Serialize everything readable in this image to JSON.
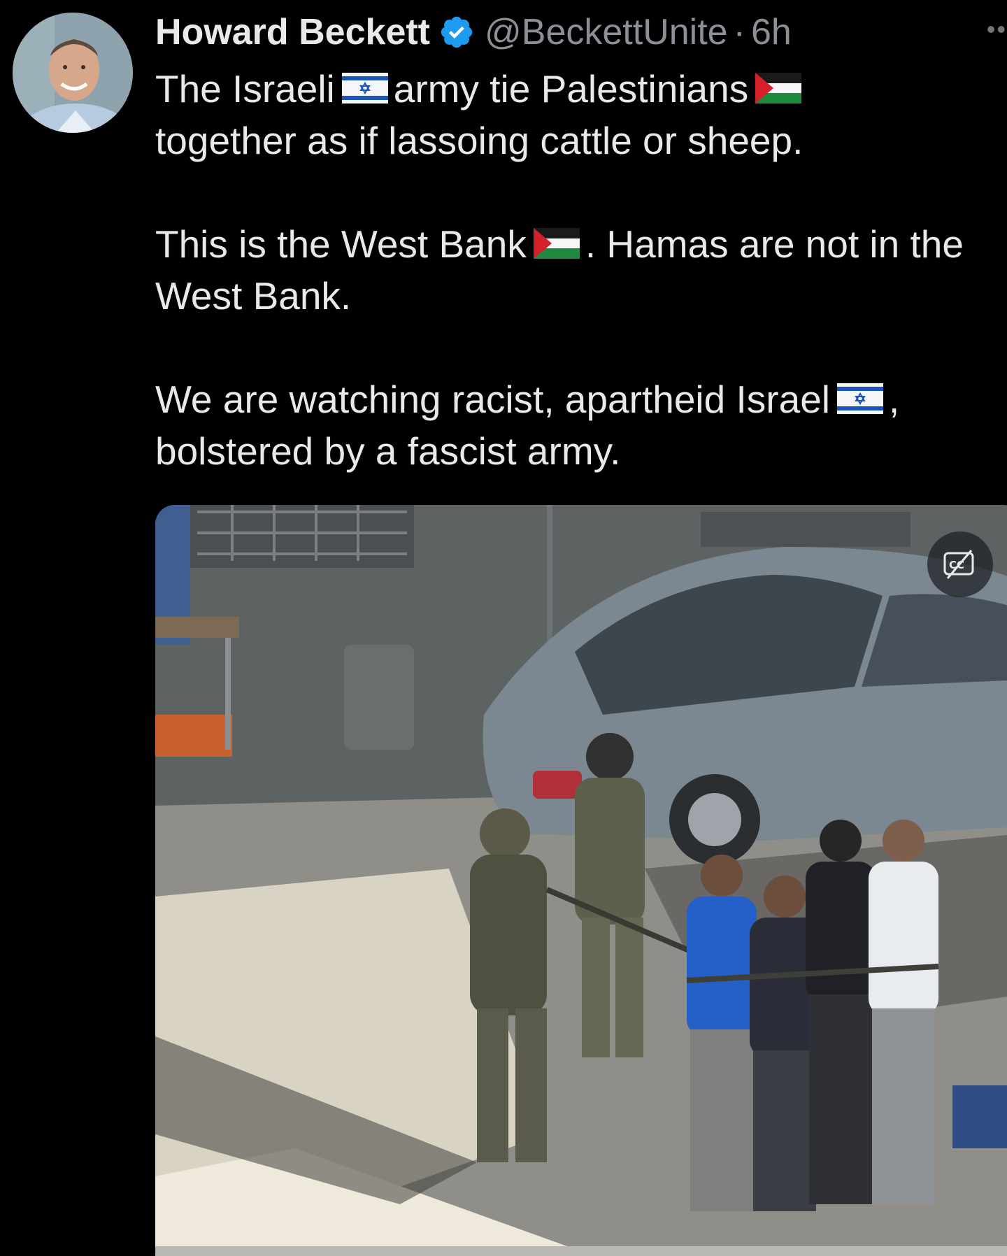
{
  "tweet": {
    "author": {
      "name": "Howard Beckett",
      "verified": true,
      "handle": "@BeckettUnite",
      "separator": "·",
      "time": "6h"
    },
    "more_menu": "••",
    "text": {
      "p1": {
        "a": "The Israeli",
        "flag_a": "israel-flag",
        "b": "army tie Palestinians",
        "flag_b": "palestine-flag",
        "line2": "together as if lassoing cattle or sheep."
      },
      "p2": {
        "a": "This is the West Bank",
        "flag": "palestine-flag",
        "b": ". Hamas are not in the",
        "line2": "West Bank."
      },
      "p3": {
        "a": "We are watching racist, apartheid Israel",
        "flag": "israel-flag",
        "b": ",",
        "line2": "bolstered by a fascist army."
      }
    },
    "media": {
      "type": "video",
      "controls": [
        "captions-icon"
      ]
    }
  },
  "colors": {
    "background": "#000000",
    "text": "#e7e9ea",
    "secondary": "#8b9096",
    "verified": "#1d9bf0"
  }
}
